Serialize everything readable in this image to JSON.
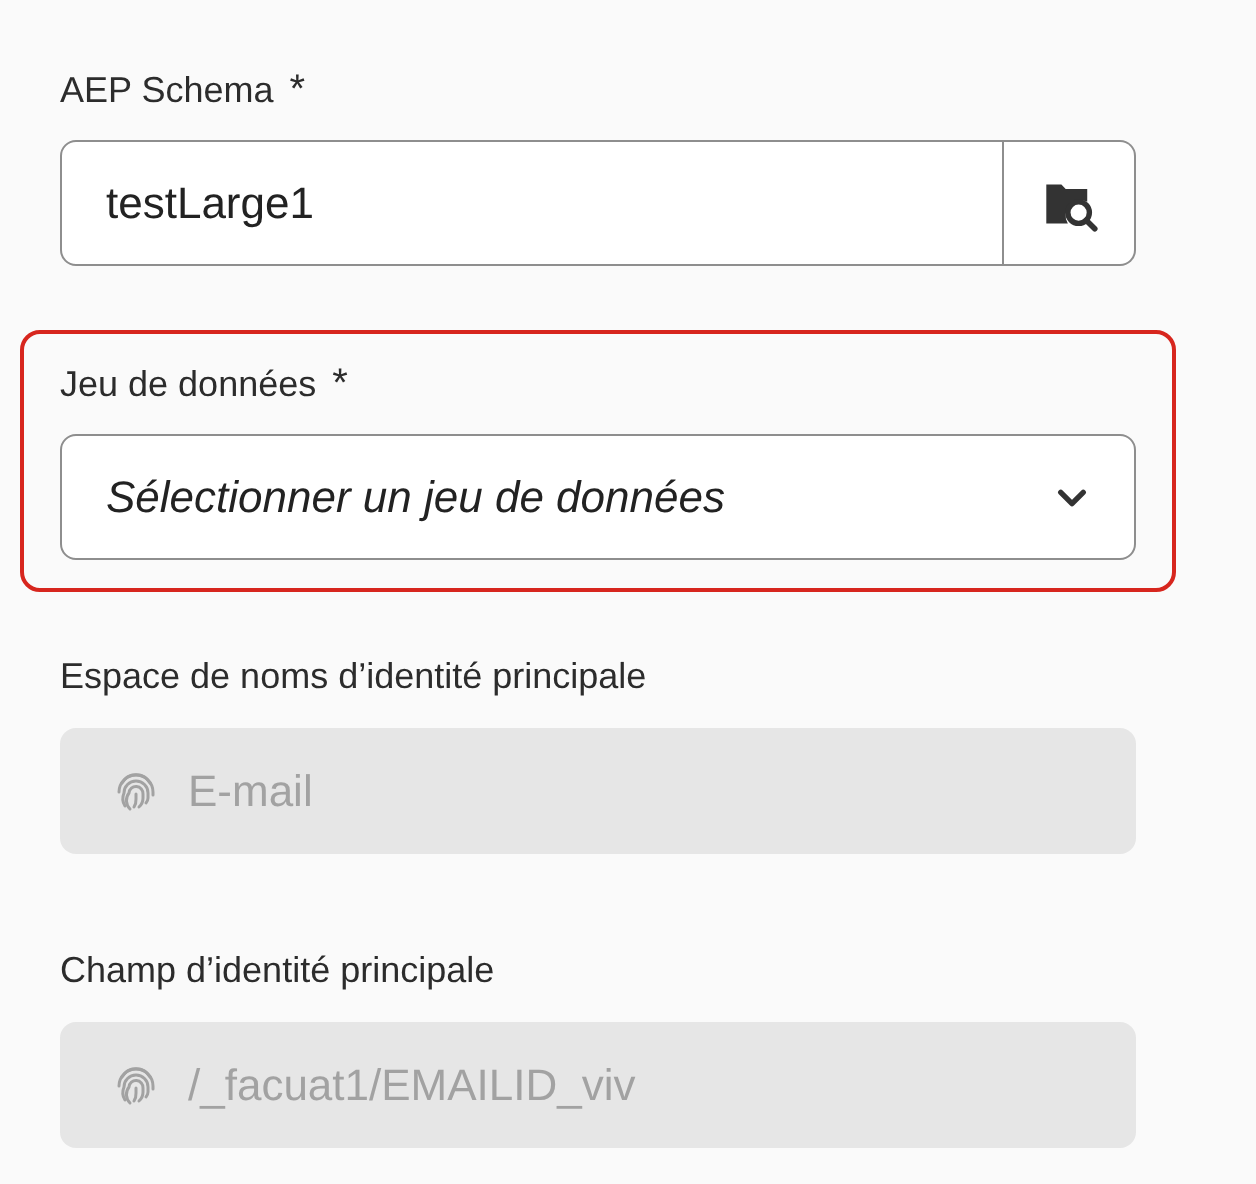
{
  "fields": [
    {
      "kind": "text",
      "label": "AEP Schema",
      "required_mark": "*",
      "value": "testLarge1"
    },
    {
      "kind": "dropdown",
      "label": "Jeu de données",
      "required_mark": "*",
      "placeholder": "Sélectionner un jeu de données",
      "highlighted": true
    },
    {
      "kind": "identity",
      "label": "Espace de noms d’identité principale",
      "value": "E-mail",
      "disabled": true
    },
    {
      "kind": "identity",
      "label": "Champ d’identité principale",
      "value": "/_facuat1/EMAILID_viv",
      "disabled": true
    }
  ]
}
